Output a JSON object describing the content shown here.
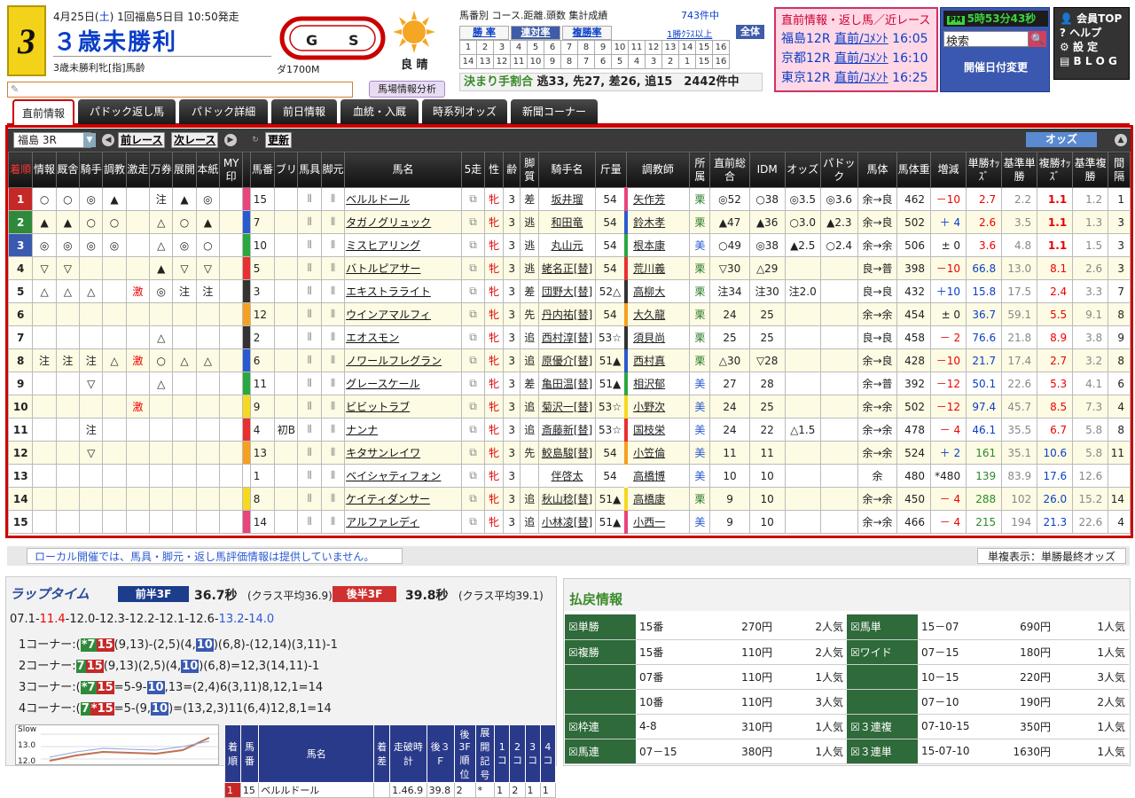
{
  "header": {
    "race_no": "3",
    "date_pre": "4月25日(",
    "weekday": "土",
    "date_post": ") 1回福島5日目 10:50発走",
    "race_name": "３歳未勝利",
    "race_sub": "3歳未勝利牝[指]馬齢",
    "course": "ダ1700M",
    "weather": "良 晴",
    "memo_icon": "pencil-icon",
    "baba_button": "馬場情報分析"
  },
  "stats": {
    "title": "馬番別 コース.距離.頭数 集計成績",
    "count": "743件中",
    "tabs": [
      "勝 率",
      "連対率",
      "複勝率"
    ],
    "class_link": "1勝ｸﾗｽ以上",
    "all_button": "全体",
    "grid_row1": [
      "1",
      "2",
      "3",
      "4",
      "5",
      "6",
      "7",
      "8",
      "9",
      "10",
      "11",
      "12",
      "13",
      "14",
      "15",
      "16"
    ],
    "grid_row2": [
      "14",
      "13",
      "12",
      "11",
      "10",
      "9",
      "8",
      "7",
      "6",
      "5",
      "4",
      "3",
      "2",
      "1",
      "15",
      "16"
    ],
    "kimari_label": "決まり手割合",
    "kimari_value": "逃33, 先27, 差26, 追15　2442件中"
  },
  "prev_info": {
    "title": "直前情報・返し馬／近レース",
    "rows": [
      {
        "place": "福島12R",
        "link": "直前/ｺﾒﾝﾄ",
        "time": "16:05"
      },
      {
        "place": "京都12R",
        "link": "直前/ｺﾒﾝﾄ",
        "time": "16:10"
      },
      {
        "place": "東京12R",
        "link": "直前/ｺﾒﾝﾄ",
        "time": "16:25"
      }
    ]
  },
  "clock": {
    "pm": "PM",
    "time": "5時53分43秒",
    "search_placeholder": "検索",
    "kaisai": "開催日付変更"
  },
  "nav": [
    "会員TOP",
    "ヘルプ",
    "設 定",
    "B L O G"
  ],
  "tabs": [
    "直前情報",
    "パドック返し馬",
    "パドック詳細",
    "前日情報",
    "血統・入厩",
    "時系列オッズ",
    "新聞コーナー"
  ],
  "controls": {
    "select": "福島 3R",
    "prev": "前レース",
    "next": "次レース",
    "update": "更新",
    "odds": "オッズ"
  },
  "table_headers": [
    "着順",
    "情報",
    "厩舎",
    "騎手",
    "調教",
    "激走",
    "万券",
    "展開",
    "本紙",
    "MY印",
    "",
    "馬番",
    "ブリ",
    "馬具",
    "脚元",
    "馬名",
    "5走",
    "性",
    "齢",
    "脚質",
    "騎手名",
    "斤量",
    "調教師",
    "所属",
    "直前総合",
    "IDM",
    "オッズ",
    "パドック",
    "馬体",
    "馬体重",
    "増減",
    "単勝ｵｯｽﾞ",
    "基準単勝",
    "複勝ｵｯｽﾞ",
    "基準複勝",
    "間隔"
  ],
  "rows": [
    {
      "rank": "1",
      "info": "○",
      "kyu": "○",
      "jk": "◎",
      "cho": "▲",
      "geki": "",
      "man": "注",
      "ten": "▲",
      "hon": "◎",
      "my": "",
      "waku": "#e8457a",
      "uma": "15",
      "buri": "",
      "name": "ベルルドール",
      "sex": "牝",
      "age": "3",
      "kyaku": "差",
      "jockey": "坂井瑠",
      "kin": "54",
      "wc": "#e8457a",
      "trainer": "矢作芳",
      "sho": "栗",
      "choku": "◎52",
      "idm": "○38",
      "odds": "◎3.5",
      "pad": "◎3.6",
      "taikei": "余→良",
      "weight": "462",
      "diff": "－10",
      "tan": "2.7",
      "ktan": "2.2",
      "fuku": "1.1",
      "kfuku": "1.2",
      "kan": "1"
    },
    {
      "rank": "2",
      "info": "▲",
      "kyu": "▲",
      "jk": "○",
      "cho": "○",
      "geki": "",
      "man": "△",
      "ten": "○",
      "hon": "▲",
      "my": "",
      "waku": "#2a5ad0",
      "uma": "7",
      "buri": "",
      "name": "タガノグリュック",
      "sex": "牝",
      "age": "3",
      "kyaku": "逃",
      "jockey": "和田竜",
      "kin": "54",
      "wc": "#2a5ad0",
      "trainer": "鈴木孝",
      "sho": "栗",
      "choku": "▲47",
      "idm": "▲36",
      "odds": "○3.0",
      "pad": "▲2.3",
      "taikei": "余→良",
      "weight": "502",
      "diff": "＋ 4",
      "tan": "2.6",
      "ktan": "3.5",
      "fuku": "1.1",
      "kfuku": "1.3",
      "kan": "3"
    },
    {
      "rank": "3",
      "info": "◎",
      "kyu": "◎",
      "jk": "◎",
      "cho": "◎",
      "geki": "",
      "man": "△",
      "ten": "◎",
      "hon": "○",
      "my": "",
      "waku": "#2aa840",
      "uma": "10",
      "buri": "",
      "name": "ミスヒアリング",
      "sex": "牝",
      "age": "3",
      "kyaku": "逃",
      "jockey": "丸山元",
      "kin": "54",
      "wc": "#2aa840",
      "trainer": "根本康",
      "sho": "美",
      "choku": "○49",
      "idm": "◎38",
      "odds": "▲2.5",
      "pad": "○2.4",
      "taikei": "余→余",
      "weight": "506",
      "diff": "± 0",
      "tan": "3.6",
      "ktan": "4.8",
      "fuku": "1.1",
      "kfuku": "1.5",
      "kan": "3"
    },
    {
      "rank": "4",
      "info": "▽",
      "kyu": "▽",
      "jk": "",
      "cho": "",
      "geki": "",
      "man": "▲",
      "ten": "▽",
      "hon": "▽",
      "my": "",
      "waku": "#e83030",
      "uma": "5",
      "buri": "",
      "name": "バトルピアサー",
      "sex": "牝",
      "age": "3",
      "kyaku": "逃",
      "jockey": "蛯名正[替]",
      "kin": "54",
      "wc": "#e83030",
      "trainer": "荒川義",
      "sho": "栗",
      "choku": "▽30",
      "idm": "△29",
      "odds": "",
      "pad": "",
      "taikei": "良→普",
      "weight": "398",
      "diff": "－10",
      "tan": "66.8",
      "ktan": "13.0",
      "fuku": "8.1",
      "kfuku": "2.6",
      "kan": "3"
    },
    {
      "rank": "5",
      "info": "△",
      "kyu": "△",
      "jk": "△",
      "cho": "",
      "geki": "激",
      "man": "◎",
      "ten": "注",
      "hon": "注",
      "my": "",
      "waku": "#333333",
      "uma": "3",
      "buri": "",
      "name": "エキストラライト",
      "sex": "牝",
      "age": "3",
      "kyaku": "差",
      "jockey": "団野大[替]",
      "kin": "52△",
      "wc": "#333333",
      "trainer": "高柳大",
      "sho": "栗",
      "choku": "注34",
      "idm": "注30",
      "odds": "注2.0",
      "pad": "",
      "taikei": "良→良",
      "weight": "432",
      "diff": "＋10",
      "tan": "15.8",
      "ktan": "17.5",
      "fuku": "2.4",
      "kfuku": "3.3",
      "kan": "7"
    },
    {
      "rank": "6",
      "info": "",
      "kyu": "",
      "jk": "",
      "cho": "",
      "geki": "",
      "man": "",
      "ten": "",
      "hon": "",
      "my": "",
      "waku": "#f5a020",
      "uma": "12",
      "buri": "",
      "name": "ウインアマルフィ",
      "sex": "牝",
      "age": "3",
      "kyaku": "先",
      "jockey": "丹内祐[替]",
      "kin": "54",
      "wc": "#f5a020",
      "trainer": "大久龍",
      "sho": "栗",
      "choku": "24",
      "idm": "25",
      "odds": "",
      "pad": "",
      "taikei": "余→余",
      "weight": "454",
      "diff": "± 0",
      "tan": "36.7",
      "ktan": "59.1",
      "fuku": "5.5",
      "kfuku": "9.1",
      "kan": "8"
    },
    {
      "rank": "7",
      "info": "",
      "kyu": "",
      "jk": "",
      "cho": "",
      "geki": "",
      "man": "△",
      "ten": "",
      "hon": "",
      "my": "",
      "waku": "#333333",
      "uma": "2",
      "buri": "",
      "name": "エオスモン",
      "sex": "牝",
      "age": "3",
      "kyaku": "追",
      "jockey": "西村淳[替]",
      "kin": "53☆",
      "wc": "#333333",
      "trainer": "須貝尚",
      "sho": "栗",
      "choku": "25",
      "idm": "25",
      "odds": "",
      "pad": "",
      "taikei": "良→良",
      "weight": "458",
      "diff": "－ 2",
      "tan": "76.6",
      "ktan": "21.8",
      "fuku": "8.9",
      "kfuku": "3.8",
      "kan": "9"
    },
    {
      "rank": "8",
      "info": "注",
      "kyu": "注",
      "jk": "注",
      "cho": "△",
      "geki": "激",
      "man": "○",
      "ten": "△",
      "hon": "△",
      "my": "",
      "waku": "#2a5ad0",
      "uma": "6",
      "buri": "",
      "name": "ノワールフレグラン",
      "sex": "牝",
      "age": "3",
      "kyaku": "追",
      "jockey": "原優介[替]",
      "kin": "51▲",
      "wc": "#2a5ad0",
      "trainer": "西村真",
      "sho": "栗",
      "choku": "△30",
      "idm": "▽28",
      "odds": "",
      "pad": "",
      "taikei": "余→良",
      "weight": "428",
      "diff": "－10",
      "tan": "21.7",
      "ktan": "17.4",
      "fuku": "2.7",
      "kfuku": "3.2",
      "kan": "8"
    },
    {
      "rank": "9",
      "info": "",
      "kyu": "",
      "jk": "▽",
      "cho": "",
      "geki": "",
      "man": "△",
      "ten": "",
      "hon": "",
      "my": "",
      "waku": "#2aa840",
      "uma": "11",
      "buri": "",
      "name": "グレースケール",
      "sex": "牝",
      "age": "3",
      "kyaku": "差",
      "jockey": "亀田温[替]",
      "kin": "51▲",
      "wc": "#2aa840",
      "trainer": "相沢郁",
      "sho": "美",
      "choku": "27",
      "idm": "28",
      "odds": "",
      "pad": "",
      "taikei": "余→普",
      "weight": "392",
      "diff": "－12",
      "tan": "50.1",
      "ktan": "22.6",
      "fuku": "5.3",
      "kfuku": "4.1",
      "kan": "6"
    },
    {
      "rank": "10",
      "info": "",
      "kyu": "",
      "jk": "",
      "cho": "",
      "geki": "激",
      "man": "",
      "ten": "",
      "hon": "",
      "my": "",
      "waku": "#f5d820",
      "uma": "9",
      "buri": "",
      "name": "ビビットラブ",
      "sex": "牝",
      "age": "3",
      "kyaku": "追",
      "jockey": "菊沢一[替]",
      "kin": "53☆",
      "wc": "#f5d820",
      "trainer": "小野次",
      "sho": "美",
      "choku": "24",
      "idm": "25",
      "odds": "",
      "pad": "",
      "taikei": "余→余",
      "weight": "502",
      "diff": "－12",
      "tan": "97.4",
      "ktan": "45.7",
      "fuku": "8.5",
      "kfuku": "7.3",
      "kan": "4"
    },
    {
      "rank": "11",
      "info": "",
      "kyu": "",
      "jk": "注",
      "cho": "",
      "geki": "",
      "man": "",
      "ten": "",
      "hon": "",
      "my": "",
      "waku": "#e83030",
      "uma": "4",
      "buri": "初B",
      "name": "ナンナ",
      "sex": "牝",
      "age": "3",
      "kyaku": "追",
      "jockey": "斎藤新[替]",
      "kin": "53☆",
      "wc": "#e83030",
      "trainer": "国枝栄",
      "sho": "美",
      "choku": "24",
      "idm": "22",
      "odds": "△1.5",
      "pad": "",
      "taikei": "余→余",
      "weight": "478",
      "diff": "－ 4",
      "tan": "46.1",
      "ktan": "35.5",
      "fuku": "6.7",
      "kfuku": "5.8",
      "kan": "8"
    },
    {
      "rank": "12",
      "info": "",
      "kyu": "",
      "jk": "▽",
      "cho": "",
      "geki": "",
      "man": "",
      "ten": "",
      "hon": "",
      "my": "",
      "waku": "#f5a020",
      "uma": "13",
      "buri": "",
      "name": "キタサンレイワ",
      "sex": "牝",
      "age": "3",
      "kyaku": "先",
      "jockey": "鮫島駿[替]",
      "kin": "54",
      "wc": "#f5a020",
      "trainer": "小笠倫",
      "sho": "美",
      "choku": "11",
      "idm": "11",
      "odds": "",
      "pad": "",
      "taikei": "余→余",
      "weight": "524",
      "diff": "＋ 2",
      "tan": "161",
      "ktan": "35.1",
      "fuku": "10.6",
      "kfuku": "5.8",
      "kan": "11"
    },
    {
      "rank": "13",
      "info": "",
      "kyu": "",
      "jk": "",
      "cho": "",
      "geki": "",
      "man": "",
      "ten": "",
      "hon": "",
      "my": "",
      "waku": "#ffffff",
      "uma": "1",
      "buri": "",
      "name": "ベイシャティフォン",
      "sex": "牝",
      "age": "3",
      "kyaku": "",
      "jockey": "伴啓太",
      "kin": "54",
      "wc": "#ffffff",
      "trainer": "高橋博",
      "sho": "美",
      "choku": "10",
      "idm": "10",
      "odds": "",
      "pad": "",
      "taikei": "余",
      "weight": "480",
      "diff": "*480",
      "tan": "139",
      "ktan": "83.9",
      "fuku": "17.6",
      "kfuku": "12.6",
      "kan": ""
    },
    {
      "rank": "14",
      "info": "",
      "kyu": "",
      "jk": "",
      "cho": "",
      "geki": "",
      "man": "",
      "ten": "",
      "hon": "",
      "my": "",
      "waku": "#f5d820",
      "uma": "8",
      "buri": "",
      "name": "ケイティダンサー",
      "sex": "牝",
      "age": "3",
      "kyaku": "追",
      "jockey": "秋山稔[替]",
      "kin": "51▲",
      "wc": "#f5d820",
      "trainer": "高橋康",
      "sho": "栗",
      "choku": "9",
      "idm": "10",
      "odds": "",
      "pad": "",
      "taikei": "余→余",
      "weight": "450",
      "diff": "－ 4",
      "tan": "288",
      "ktan": "102",
      "fuku": "26.0",
      "kfuku": "15.2",
      "kan": "14"
    },
    {
      "rank": "15",
      "info": "",
      "kyu": "",
      "jk": "",
      "cho": "",
      "geki": "",
      "man": "",
      "ten": "",
      "hon": "",
      "my": "",
      "waku": "#e8457a",
      "uma": "14",
      "buri": "",
      "name": "アルファレディ",
      "sex": "牝",
      "age": "3",
      "kyaku": "追",
      "jockey": "小林凌[替]",
      "kin": "51▲",
      "wc": "#e8457a",
      "trainer": "小西一",
      "sho": "美",
      "choku": "9",
      "idm": "10",
      "odds": "",
      "pad": "",
      "taikei": "余→余",
      "weight": "466",
      "diff": "－ 4",
      "tan": "215",
      "ktan": "194",
      "fuku": "21.3",
      "kfuku": "22.6",
      "kan": "4"
    }
  ],
  "rank_colors": [
    "#c62828",
    "#2e8a3a",
    "#3a5ab0"
  ],
  "footer": {
    "note_left": "ローカル開催では、馬具・脚元・返し馬評価情報は提供していません。",
    "note_right": "単複表示：単勝最終オッズ"
  },
  "lap": {
    "title": "ラップタイム",
    "mae_label": "前半3F",
    "mae_value": "36.7秒",
    "mae_avg": "(クラス平均36.9)",
    "ato_label": "後半3F",
    "ato_value": "39.8秒",
    "ato_avg": "(クラス平均39.1)",
    "laps": [
      "07.1",
      "11.4",
      "12.0",
      "12.3",
      "12.2",
      "12.1",
      "12.6",
      "13.2",
      "14.0"
    ],
    "corners": [
      {
        "label": "1コーナー:(",
        "seq": [
          [
            "*7",
            "g"
          ],
          [
            "15",
            "r"
          ]
        ],
        "rest": "(9,13)-(2,5)(4,",
        "b": "10",
        "tail": ")(6,8)-(12,14)(3,11)-1"
      },
      {
        "label": "2コーナー:",
        "seq": [
          [
            "7",
            "g"
          ],
          [
            "15",
            "r"
          ]
        ],
        "rest": "(9,13)(2,5)(4,",
        "b": "10",
        "tail": ")(6,8)=12,3(14,11)-1"
      },
      {
        "label": "3コーナー:(",
        "seq": [
          [
            "*7",
            "g"
          ],
          [
            "15",
            "r"
          ]
        ],
        "rest": "=5-9-",
        "b": "10",
        "tail": ",13=(2,4)6(3,11)8,12,1=14"
      },
      {
        "label": "4コーナー:(",
        "seq": [
          [
            "7",
            "g"
          ],
          [
            "*15",
            "r"
          ]
        ],
        "rest": "=5-(9,",
        "b": "10",
        "tail": ")=(13,2,3)11(6,4)12,8,1=14"
      }
    ],
    "chart_axis": [
      "Slow",
      "13.0",
      "12.0"
    ],
    "table_headers": [
      "着順",
      "馬番",
      "馬名",
      "着差",
      "走破時計",
      "後３Ｆ",
      "後3F順位",
      "展開記号",
      "1コ",
      "2コ",
      "3コ",
      "4コ"
    ],
    "table_row": [
      "1",
      "15",
      "ベルルドール",
      "",
      "1.46.9",
      "39.8",
      "2",
      "*",
      "1",
      "2",
      "1",
      "1"
    ]
  },
  "pay": {
    "title": "払戻情報",
    "rows": [
      {
        "l": "単勝",
        "a": "15番",
        "b": "270円",
        "c": "2人気",
        "l2": "馬単",
        "d": "15－07",
        "e": "690円",
        "f": "1人気"
      },
      {
        "l": "複勝",
        "a": "15番",
        "b": "110円",
        "c": "2人気",
        "l2": "ワイド",
        "d": "07－15",
        "e": "180円",
        "f": "1人気"
      },
      {
        "l": "",
        "a": "07番",
        "b": "110円",
        "c": "1人気",
        "l2": "",
        "d": "10－15",
        "e": "220円",
        "f": "3人気"
      },
      {
        "l": "",
        "a": "10番",
        "b": "110円",
        "c": "3人気",
        "l2": "",
        "d": "07－10",
        "e": "190円",
        "f": "2人気"
      },
      {
        "l": "枠連",
        "a": "4-8",
        "b": "310円",
        "c": "1人気",
        "l2": "３連複",
        "d": "07-10-15",
        "e": "350円",
        "f": "1人気"
      },
      {
        "l": "馬連",
        "a": "07－15",
        "b": "380円",
        "c": "1人気",
        "l2": "３連単",
        "d": "15-07-10",
        "e": "1630円",
        "f": "1人気"
      }
    ]
  }
}
